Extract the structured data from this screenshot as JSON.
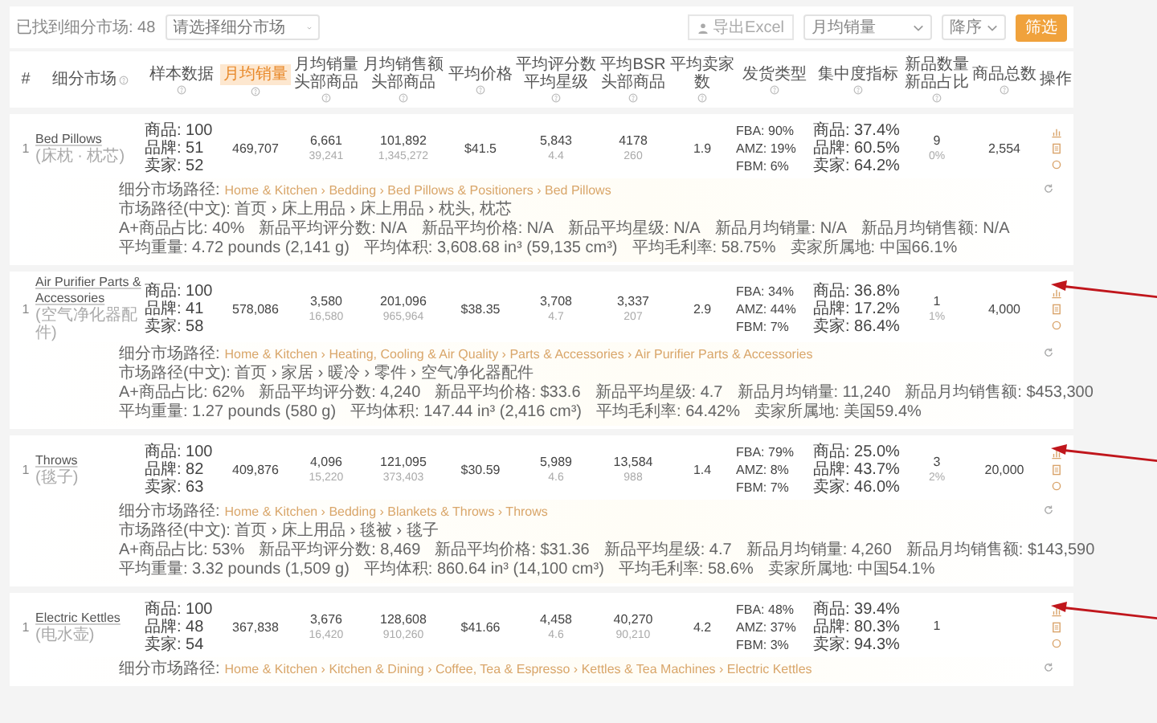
{
  "toolbar": {
    "count_label": "已找到细分市场: 48",
    "market_select": {
      "placeholder": "请选择细分市场"
    },
    "export_button": "导出Excel",
    "sort_select": "月均销量",
    "order_select": "降序",
    "filter_button": "筛选"
  },
  "columns": [
    {
      "label": "#",
      "info": false,
      "selected": false
    },
    {
      "label": "细分市场",
      "info": true,
      "selected": false
    },
    {
      "label": "样本数据",
      "info": true,
      "selected": false
    },
    {
      "label": "月均销量",
      "info": true,
      "selected": true
    },
    {
      "label": "月均销量头部商品",
      "info": true,
      "selected": false
    },
    {
      "label": "月均销售额头部商品",
      "info": true,
      "selected": false
    },
    {
      "label": "平均价格",
      "info": true,
      "selected": false
    },
    {
      "label": "平均评分数平均星级",
      "info": true,
      "selected": false
    },
    {
      "label": "平均BSR头部商品",
      "info": true,
      "selected": false
    },
    {
      "label": "平均卖家数",
      "info": true,
      "selected": false
    },
    {
      "label": "发货类型",
      "info": true,
      "selected": false
    },
    {
      "label": "集中度指标",
      "info": true,
      "selected": false
    },
    {
      "label": "新品数量新品占比",
      "info": true,
      "selected": false
    },
    {
      "label": "商品总数",
      "info": true,
      "selected": false
    },
    {
      "label": "操作",
      "info": false,
      "selected": false
    }
  ],
  "rows": [
    {
      "index": "1",
      "name": "Bed Pillows",
      "name_cn": "(床枕 · 枕芯)",
      "sample": [
        "商品: 100",
        "品牌: 51",
        "卖家: 52"
      ],
      "monthly_sales": "469,707",
      "top_sales": [
        "6,661",
        "39,241"
      ],
      "top_revenue": [
        "101,892",
        "1,345,272"
      ],
      "avg_price": "$41.5",
      "rating": [
        "5,843",
        "4.4"
      ],
      "bsr": [
        "4178",
        "260"
      ],
      "sellers": "1.9",
      "fulfillment": [
        "FBA: 90%",
        "AMZ: 19%",
        "FBM: 6%"
      ],
      "concentration": [
        "商品: 37.4%",
        "品牌: 60.5%",
        "卖家: 64.2%"
      ],
      "new_items": [
        "9",
        "0%"
      ],
      "total": "2,554",
      "arrow": false,
      "details": {
        "path_label": "细分市场路径:",
        "path": "Home & Kitchen › Bedding › Bed Pillows & Positioners › Bed Pillows",
        "lines": [
          [
            "市场路径(中文): 首页 › 床上用品 › 床上用品 › 枕头, 枕芯"
          ],
          [
            "A+商品占比: 40%",
            "新品平均评分数: N/A",
            "新品平均价格: N/A",
            "新品平均星级: N/A",
            "新品月均销量: N/A",
            "新品月均销售额: N/A"
          ],
          [
            "平均重量: 4.72 pounds (2,141 g)",
            "平均体积: 3,608.68 in³ (59,135 cm³)",
            "平均毛利率: 58.75%",
            "卖家所属地: 中国66.1%"
          ]
        ]
      }
    },
    {
      "index": "1",
      "name": "Air Purifier Parts & Accessories",
      "name_cn": "(空气净化器配件)",
      "sample": [
        "商品: 100",
        "品牌: 41",
        "卖家: 58"
      ],
      "monthly_sales": "578,086",
      "top_sales": [
        "3,580",
        "16,580"
      ],
      "top_revenue": [
        "201,096",
        "965,964"
      ],
      "avg_price": "$38.35",
      "rating": [
        "3,708",
        "4.7"
      ],
      "bsr": [
        "3,337",
        "207"
      ],
      "sellers": "2.9",
      "fulfillment": [
        "FBA: 34%",
        "AMZ: 44%",
        "FBM: 7%"
      ],
      "concentration": [
        "商品: 36.8%",
        "品牌: 17.2%",
        "卖家: 86.4%"
      ],
      "new_items": [
        "1",
        "1%"
      ],
      "total": "4,000",
      "arrow": true,
      "details": {
        "path_label": "细分市场路径:",
        "path": "Home & Kitchen › Heating, Cooling & Air Quality › Parts & Accessories › Air Purifier Parts & Accessories",
        "lines": [
          [
            "市场路径(中文): 首页 › 家居 › 暖冷 › 零件 › 空气净化器配件"
          ],
          [
            "A+商品占比: 62%",
            "新品平均评分数: 4,240",
            "新品平均价格: $33.6",
            "新品平均星级: 4.7",
            "新品月均销量: 11,240",
            "新品月均销售额: $453,300"
          ],
          [
            "平均重量: 1.27 pounds (580 g)",
            "平均体积: 147.44 in³ (2,416 cm³)",
            "平均毛利率: 64.42%",
            "卖家所属地: 美国59.4%"
          ]
        ]
      }
    },
    {
      "index": "1",
      "name": "Throws",
      "name_cn": "(毯子)",
      "sample": [
        "商品: 100",
        "品牌: 82",
        "卖家: 63"
      ],
      "monthly_sales": "409,876",
      "top_sales": [
        "4,096",
        "15,220"
      ],
      "top_revenue": [
        "121,095",
        "373,403"
      ],
      "avg_price": "$30.59",
      "rating": [
        "5,989",
        "4.6"
      ],
      "bsr": [
        "13,584",
        "988"
      ],
      "sellers": "1.4",
      "fulfillment": [
        "FBA: 79%",
        "AMZ: 8%",
        "FBM: 7%"
      ],
      "concentration": [
        "商品: 25.0%",
        "品牌: 43.7%",
        "卖家: 46.0%"
      ],
      "new_items": [
        "3",
        "2%"
      ],
      "total": "20,000",
      "arrow": true,
      "details": {
        "path_label": "细分市场路径:",
        "path": "Home & Kitchen › Bedding › Blankets & Throws › Throws",
        "lines": [
          [
            "市场路径(中文): 首页 › 床上用品 › 毯被 › 毯子"
          ],
          [
            "A+商品占比: 53%",
            "新品平均评分数: 8,469",
            "新品平均价格: $31.36",
            "新品平均星级: 4.7",
            "新品月均销量: 4,260",
            "新品月均销售额: $143,590"
          ],
          [
            "平均重量: 3.32 pounds (1,509 g)",
            "平均体积: 860.64 in³ (14,100 cm³)",
            "平均毛利率: 58.6%",
            "卖家所属地: 中国54.1%"
          ]
        ]
      }
    },
    {
      "index": "1",
      "name": "Electric Kettles",
      "name_cn": "(电水壶)",
      "sample": [
        "商品: 100",
        "品牌: 48",
        "卖家: 54"
      ],
      "monthly_sales": "367,838",
      "top_sales": [
        "3,676",
        "16,420"
      ],
      "top_revenue": [
        "128,608",
        "910,260"
      ],
      "avg_price": "$41.66",
      "rating": [
        "4,458",
        "4.6"
      ],
      "bsr": [
        "40,270",
        "90,210"
      ],
      "sellers": "4.2",
      "fulfillment": [
        "FBA: 48%",
        "AMZ: 37%",
        "FBM: 3%"
      ],
      "concentration": [
        "商品: 39.4%",
        "品牌: 80.3%",
        "卖家: 94.3%"
      ],
      "new_items": [
        "1"
      ],
      "arrow": true,
      "details": {
        "path_label": "细分市场路径:",
        "path": "Home & Kitchen › Kitchen & Dining › Coffee, Tea & Espresso › Kettles & Tea Machines › Electric Kettles"
      }
    }
  ]
}
